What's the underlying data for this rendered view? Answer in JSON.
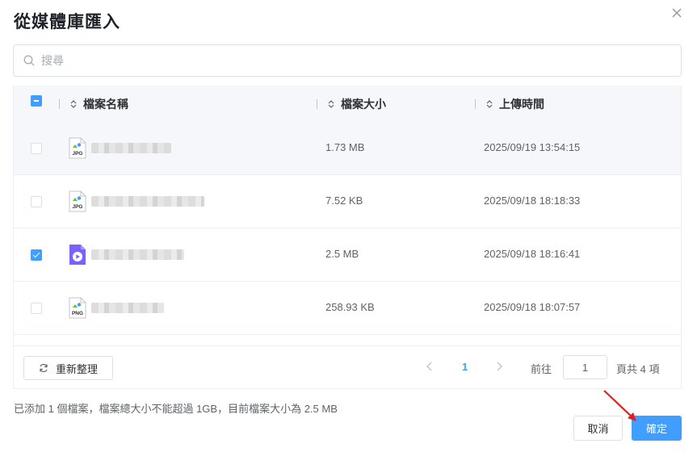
{
  "dialog": {
    "title": "從媒體庫匯入",
    "search_placeholder": "搜尋"
  },
  "table": {
    "columns": [
      "檔案名稱",
      "檔案大小",
      "上傳時間"
    ],
    "rows": [
      {
        "type": "JPG",
        "size": "1.73 MB",
        "time": "2025/09/19 13:54:15",
        "checked": false
      },
      {
        "type": "JPG",
        "size": "7.52 KB",
        "time": "2025/09/18 18:18:33",
        "checked": false
      },
      {
        "type": "video",
        "size": "2.5 MB",
        "time": "2025/09/18 18:16:41",
        "checked": true
      },
      {
        "type": "PNG",
        "size": "258.93 KB",
        "time": "2025/09/18 18:07:57",
        "checked": false
      }
    ]
  },
  "pager": {
    "refresh_label": "重新整理",
    "current_page": "1",
    "goto_label": "前往",
    "goto_value": "1",
    "total_label": "頁共 4 項"
  },
  "footer": {
    "status": "已添加 1 個檔案，檔案總大小不能超過 1GB，目前檔案大小為 2.5 MB",
    "cancel_label": "取消",
    "confirm_label": "確定"
  },
  "colors": {
    "accent": "#409eff",
    "video_icon": "#7b61ff",
    "arrow": "#e02020"
  }
}
